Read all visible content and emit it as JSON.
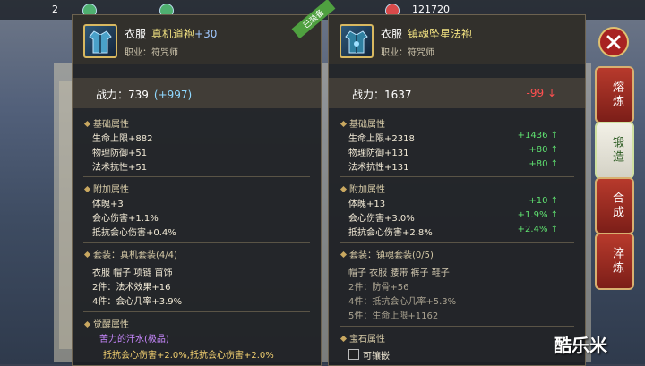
{
  "topbar": {
    "left_count": "2",
    "right_count": "121720"
  },
  "left": {
    "slot": "衣服",
    "name": "真机道袍",
    "plus": "+30",
    "job": "职业：符咒师",
    "power": "战力：739",
    "power_delta": "(+997)",
    "sec_base": "基础属性",
    "base": [
      "生命上限+882",
      "物理防御+51",
      "法术抗性+51"
    ],
    "sec_extra": "附加属性",
    "extra": [
      "体魄+3",
      "会心伤害+1.1%",
      "抵抗会心伤害+0.4%"
    ],
    "set_title": "套装：真机套装(4/4)",
    "set_parts": "衣服  帽子  项链  首饰",
    "set_bonus": [
      "2件：法术效果+16",
      "4件：会心几率+3.9%"
    ],
    "sec_awaken": "觉醒属性",
    "awaken_name": "苦力的汗水(极品)",
    "awaken_desc": "抵抗会心伤害+2.0%,抵抗会心伤害+2.0%",
    "tag": "已装备"
  },
  "right": {
    "slot": "衣服",
    "name": "镇魂坠星法袍",
    "job": "职业：符咒师",
    "power": "战力：1637",
    "power_delta": "-99 ↓",
    "sec_base": "基础属性",
    "base": [
      "生命上限+2318",
      "物理防御+131",
      "法术抗性+131"
    ],
    "base_diff": [
      "+1436 ↑",
      "+80 ↑",
      "+80 ↑"
    ],
    "sec_extra": "附加属性",
    "extra": [
      "体魄+13",
      "会心伤害+3.0%",
      "抵抗会心伤害+2.8%"
    ],
    "extra_diff": [
      "+10 ↑",
      "+1.9% ↑",
      "+2.4% ↑"
    ],
    "set_title": "套装：镇魂套装(0/5)",
    "set_parts": "帽子  衣服  腰带  裤子  鞋子",
    "set_bonus": [
      "2件：防骨+56",
      "4件：抵抗会心几率+5.3%",
      "5件：生命上限+1162"
    ],
    "sec_gem": "宝石属性",
    "gem_slot": "可镶嵌"
  },
  "side_buttons": [
    "熔炼",
    "锻造",
    "合成",
    "淬炼"
  ],
  "watermark": "酷乐米"
}
